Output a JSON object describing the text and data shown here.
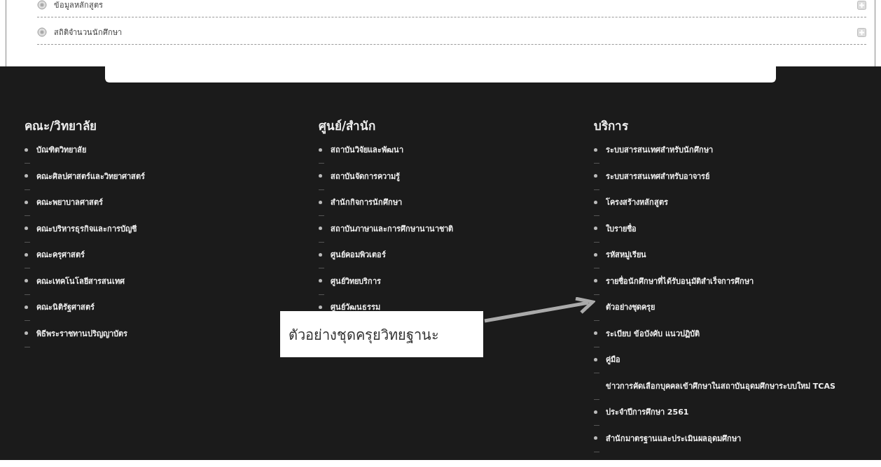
{
  "accordion": [
    {
      "label": "ข้อมูลหลักสูตร"
    },
    {
      "label": "สถิติจำนวนนักศึกษา"
    }
  ],
  "footer_columns": [
    {
      "heading": "คณะ/วิทยาลัย",
      "items": [
        {
          "label": "บัณฑิตวิทยาลัย",
          "bullet": true
        },
        {
          "label": "คณะศิลปศาสตร์และวิทยาศาสตร์",
          "bullet": true
        },
        {
          "label": "คณะพยาบาลศาสตร์",
          "bullet": true
        },
        {
          "label": "คณะบริหารธุรกิจและการบัญชี",
          "bullet": true
        },
        {
          "label": "คณะครุศาสตร์",
          "bullet": true
        },
        {
          "label": "คณะเทคโนโลยีสารสนเทศ",
          "bullet": true
        },
        {
          "label": "คณะนิติรัฐศาสตร์",
          "bullet": true
        },
        {
          "label": "พิธีพระราชทานปริญญาบัตร",
          "bullet": true
        }
      ]
    },
    {
      "heading": "ศูนย์/สำนัก",
      "items": [
        {
          "label": "สถาบันวิจัยและพัฒนา",
          "bullet": true
        },
        {
          "label": "สถาบันจัดการความรู้",
          "bullet": true
        },
        {
          "label": "สำนักกิจการนักศึกษา",
          "bullet": true
        },
        {
          "label": "สถาบันภาษาและการศึกษานานาชาติ",
          "bullet": true
        },
        {
          "label": "ศูนย์คอมพิวเตอร์",
          "bullet": true
        },
        {
          "label": "ศูนย์วิทยบริการ",
          "bullet": true
        },
        {
          "label": "ศูนย์วัฒนธรรม",
          "bullet": true
        }
      ]
    },
    {
      "heading": "บริการ",
      "items": [
        {
          "label": "ระบบสารสนเทศสำหรับนักศึกษา",
          "bullet": true
        },
        {
          "label": "ระบบสารสนเทศสำหรับอาจารย์",
          "bullet": true
        },
        {
          "label": "โครงสร้างหลักสูตร",
          "bullet": true
        },
        {
          "label": "ใบรายชื่อ",
          "bullet": true
        },
        {
          "label": "รหัสหมู่เรียน",
          "bullet": true
        },
        {
          "label": "รายชื่อนักศึกษาที่ได้รับอนุมัติสำเร็จการศึกษา",
          "bullet": true
        },
        {
          "label": "ตัวอย่างชุดครุย",
          "bullet": false
        },
        {
          "label": "ระเบียบ ข้อบังคับ แนวปฏิบัติ",
          "bullet": true
        },
        {
          "label": "คู่มือ",
          "bullet": true
        },
        {
          "label": "ข่าวการคัดเลือกบุคคลเข้าศึกษาในสถาบันอุดมศึกษาระบบใหม่ TCAS",
          "bullet": false
        },
        {
          "label": "ประจำปีการศึกษา 2561",
          "bullet": true
        },
        {
          "label": "สำนักมาตรฐานและประเมินผลอุดมศึกษา",
          "bullet": true
        }
      ]
    }
  ],
  "callout": {
    "text": "ตัวอย่างชุดครุยวิทยฐานะ"
  }
}
